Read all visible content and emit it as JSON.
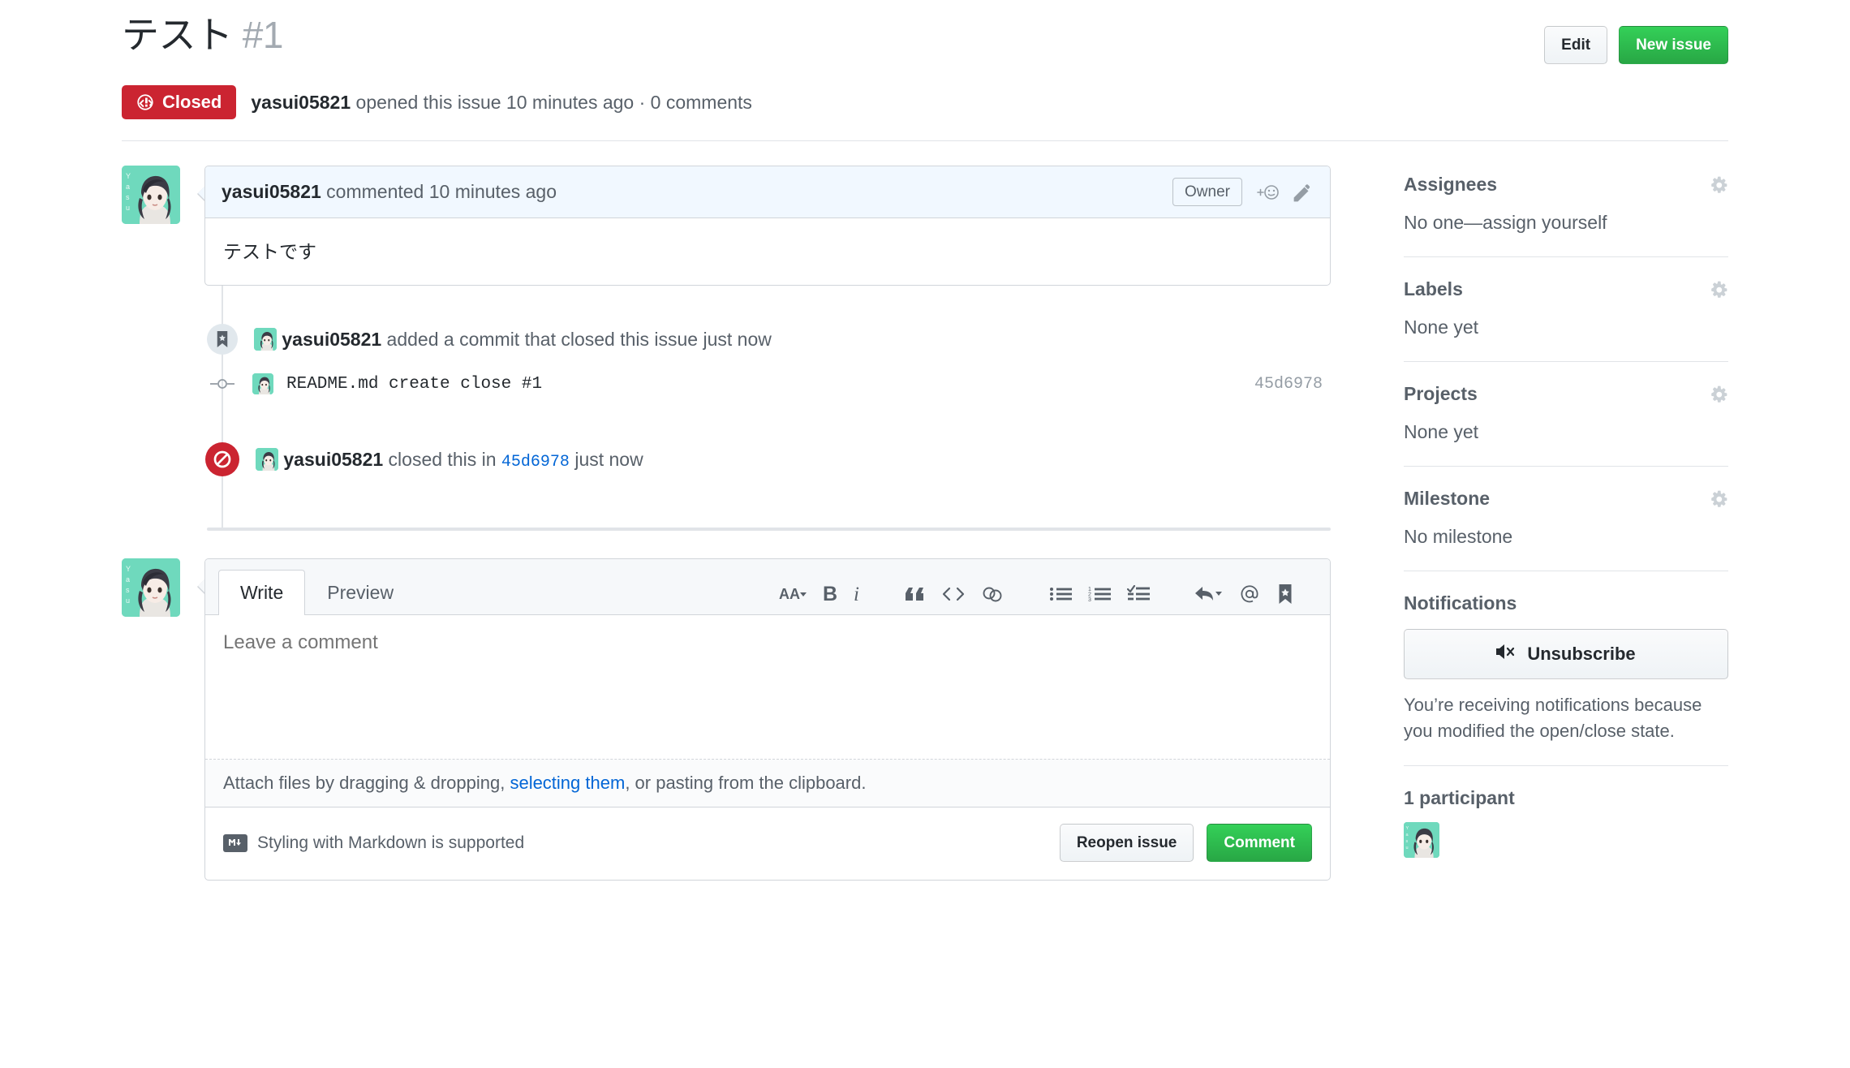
{
  "header": {
    "title": "テスト",
    "issue_number": "#1",
    "edit_label": "Edit",
    "new_issue_label": "New issue"
  },
  "state": {
    "badge_label": "Closed",
    "badge_color": "#cb2431",
    "author": "yasui05821",
    "meta_mid": " opened this issue 10 minutes ago · ",
    "comments_count": "0 comments"
  },
  "comment": {
    "author": "yasui05821",
    "action_text": " commented 10 minutes ago",
    "role_badge": "Owner",
    "reaction_icon": "smiley-plus-icon",
    "edit_icon": "pencil-icon",
    "body": "テストです"
  },
  "timeline": {
    "commit_event": {
      "icon": "bookmark-icon",
      "author": "yasui05821",
      "text": " added a commit that closed this issue just now"
    },
    "commit_row": {
      "icon": "git-commit-icon",
      "message": "README.md create close #1",
      "sha": "45d6978"
    },
    "closed_event": {
      "icon": "issue-closed-icon",
      "author": "yasui05821",
      "text_before": " closed this in ",
      "sha": "45d6978",
      "text_after": " just now"
    }
  },
  "form": {
    "tabs": [
      {
        "label": "Write",
        "active": true
      },
      {
        "label": "Preview",
        "active": false
      }
    ],
    "toolbar": [
      {
        "name": "heading-icon",
        "glyph": "AA"
      },
      {
        "name": "bold-icon",
        "glyph": "B"
      },
      {
        "name": "italic-icon",
        "glyph": "i"
      },
      {
        "name": "quote-icon",
        "glyph": "“"
      },
      {
        "name": "code-icon",
        "glyph": "<>"
      },
      {
        "name": "link-icon",
        "glyph": "link"
      },
      {
        "name": "unordered-list-icon",
        "glyph": "list"
      },
      {
        "name": "ordered-list-icon",
        "glyph": "1."
      },
      {
        "name": "task-list-icon",
        "glyph": "check"
      },
      {
        "name": "reply-icon",
        "glyph": "reply"
      },
      {
        "name": "mention-icon",
        "glyph": "@"
      },
      {
        "name": "saved-replies-icon",
        "glyph": "bookmark"
      }
    ],
    "textarea_placeholder": "Leave a comment",
    "textarea_value": "",
    "attach_before": "Attach files by dragging & dropping, ",
    "attach_link": "selecting them",
    "attach_after": ", or pasting from the clipboard.",
    "markdown_note": "Styling with Markdown is supported",
    "markdown_logo": "M↓",
    "reopen_label": "Reopen issue",
    "comment_label": "Comment"
  },
  "sidebar": {
    "sections": [
      {
        "title": "Assignees",
        "value": "No one—assign yourself",
        "gear": "gear-icon"
      },
      {
        "title": "Labels",
        "value": "None yet",
        "gear": "gear-icon"
      },
      {
        "title": "Projects",
        "value": "None yet",
        "gear": "gear-icon"
      },
      {
        "title": "Milestone",
        "value": "No milestone",
        "gear": "gear-icon"
      }
    ],
    "notifications": {
      "title": "Notifications",
      "button_label": "Unsubscribe",
      "button_icon": "mute-icon",
      "note": "You’re receiving notifications because you modified the open/close state."
    },
    "participants": {
      "title": "1 participant"
    }
  },
  "colors": {
    "closed_red": "#cb2431",
    "green": "#28a745",
    "link_blue": "#0366d6",
    "muted": "#586069",
    "border": "#d1d5da"
  }
}
